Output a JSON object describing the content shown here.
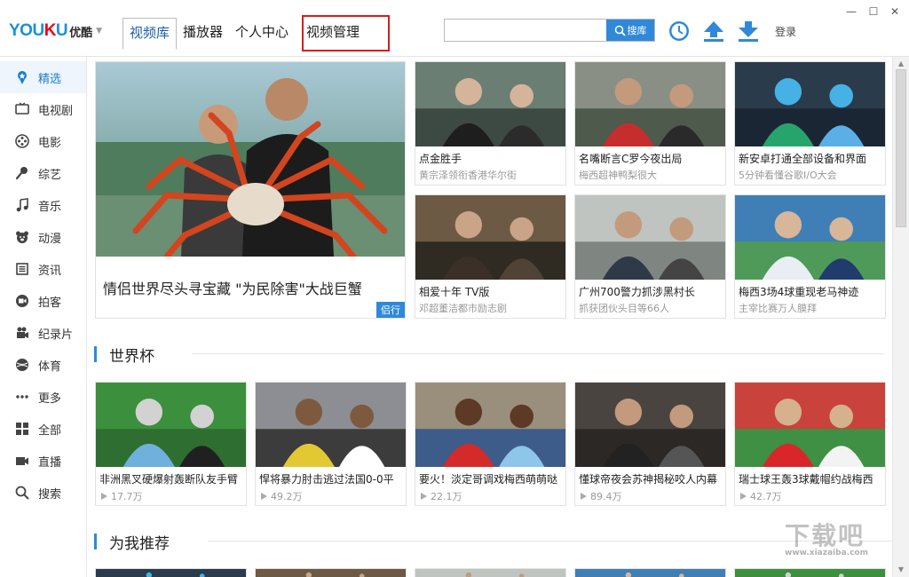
{
  "app": {
    "logo_en": "YOUKU",
    "logo_cn": "优酷"
  },
  "nav": {
    "tabs": [
      {
        "label": "视频库",
        "active": true
      },
      {
        "label": "播放器"
      },
      {
        "label": "个人中心"
      },
      {
        "label": "视频管理",
        "highlighted": true
      }
    ]
  },
  "search": {
    "value": "",
    "button_label": "搜库"
  },
  "toolbar": {
    "icons": [
      "history-clock-icon",
      "upload-icon",
      "download-icon"
    ],
    "login_label": "登录"
  },
  "window": {
    "controls": [
      "minimize",
      "maximize",
      "close"
    ],
    "minimize_glyph": "—",
    "maximize_glyph": "☐",
    "close_glyph": "✕"
  },
  "sidebar": {
    "items": [
      {
        "label": "精选",
        "icon": "badge-icon",
        "active": true
      },
      {
        "label": "电视剧",
        "icon": "tv-icon"
      },
      {
        "label": "电影",
        "icon": "film-reel-icon"
      },
      {
        "label": "综艺",
        "icon": "microphone-icon"
      },
      {
        "label": "音乐",
        "icon": "music-note-icon"
      },
      {
        "label": "动漫",
        "icon": "bear-face-icon"
      },
      {
        "label": "资讯",
        "icon": "news-icon"
      },
      {
        "label": "拍客",
        "icon": "camcorder-icon"
      },
      {
        "label": "纪录片",
        "icon": "movie-camera-icon"
      },
      {
        "label": "体育",
        "icon": "ball-icon"
      },
      {
        "label": "更多",
        "icon": "more-dots-icon"
      },
      {
        "label": "全部",
        "icon": "grid-icon"
      },
      {
        "label": "直播",
        "icon": "live-camera-icon"
      },
      {
        "label": "搜索",
        "icon": "search-icon"
      }
    ]
  },
  "featured": {
    "hero": {
      "title": "情侣世界尽头寻宝藏 \"为民除害\"大战巨蟹",
      "tag": "侣行"
    },
    "cards": [
      {
        "title": "点金胜手",
        "subtitle": "黄宗泽领衔香港华尔街"
      },
      {
        "title": "名嘴断言C罗今夜出局",
        "subtitle": "梅西超神鸭梨很大"
      },
      {
        "title": "新安卓打通全部设备和界面",
        "subtitle": "5分钟看懂谷歌I/O大会"
      },
      {
        "title": "相爱十年 TV版",
        "subtitle": "邓超董洁都市励志剧"
      },
      {
        "title": "广州700警力抓涉黑村长",
        "subtitle": "抓获团伙头目等66人"
      },
      {
        "title": "梅西3场4球重现老马神迹",
        "subtitle": "主宰比赛万人膜拜"
      }
    ]
  },
  "sections": [
    {
      "title": "世界杯",
      "cards": [
        {
          "title": "非洲黑叉硬爆射轰断队友手臂",
          "plays": "17.7万"
        },
        {
          "title": "悍将暴力肘击逃过法国0-0平",
          "plays": "49.2万"
        },
        {
          "title": "要火！淡定哥调戏梅西萌萌哒",
          "plays": "22.1万"
        },
        {
          "title": "懂球帝夜会苏神揭秘咬人内幕",
          "plays": "89.4万"
        },
        {
          "title": "瑞士球王轰3球戴帽约战梅西",
          "plays": "42.7万"
        }
      ]
    },
    {
      "title": "为我推荐",
      "cards": []
    }
  ],
  "scrollbar": {
    "up_glyph": "▲",
    "down_glyph": "▼"
  },
  "watermark": {
    "main": "下载吧",
    "sub": "www.xiazaiba.com"
  },
  "colors": {
    "accent": "#2f89d8",
    "highlight_box": "#d81c1c",
    "active_text": "#1a7fd4"
  }
}
